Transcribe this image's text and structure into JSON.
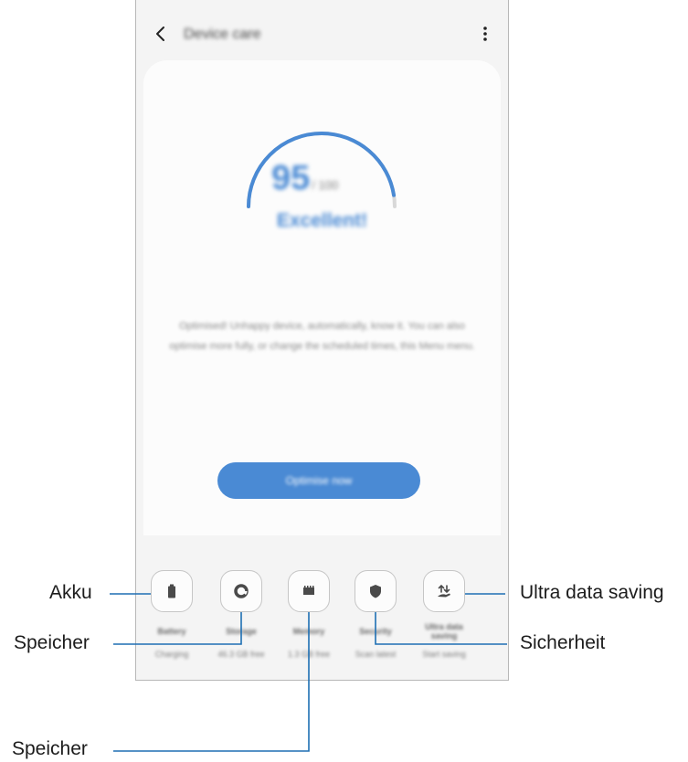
{
  "app": {
    "title": "Device care",
    "back_icon": "chevron-left-icon",
    "more_icon": "more-vertical-icon"
  },
  "score": {
    "value": "95",
    "max": "/ 100",
    "progress": 0.95,
    "status": "Excellent!"
  },
  "description": "Optimised! Unhappy device, automatically, know it. You can also optimise more fully, or change the scheduled times, this Menu menu.",
  "optimize_button": "Optimise now",
  "tiles": [
    {
      "name": "Battery",
      "status": "Charging",
      "icon": "battery-icon"
    },
    {
      "name": "Storage",
      "status": "46.3 GB free",
      "icon": "storage-pie-icon"
    },
    {
      "name": "Memory",
      "status": "1.3 GB free",
      "icon": "memory-chip-icon"
    },
    {
      "name": "Security",
      "status": "Scan latest",
      "icon": "shield-icon"
    },
    {
      "name": "Ultra data saving",
      "status": "Start saving",
      "icon": "data-saving-icon"
    }
  ],
  "callouts": {
    "akku": "Akku",
    "speicher_1": "Speicher",
    "speicher_2": "Speicher",
    "ultra_data_saving": "Ultra data saving",
    "sicherheit": "Sicherheit"
  },
  "colors": {
    "accent": "#4a8ad4",
    "leader_line": "#1e6fb3",
    "card": "#fcfcfc",
    "screen_bg": "#f4f4f4"
  }
}
